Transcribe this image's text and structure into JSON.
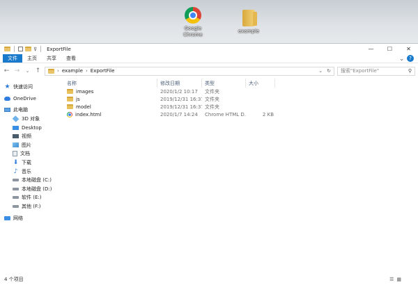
{
  "desktop": {
    "icons": [
      {
        "label_line1": "Google",
        "label_line2": "Chrome",
        "icon": "chrome-icon"
      },
      {
        "label_line1": "example",
        "label_line2": "",
        "icon": "folder-icon"
      }
    ]
  },
  "window": {
    "title": "ExportFile",
    "controls": {
      "minimize": "—",
      "maximize": "☐",
      "close": "✕"
    }
  },
  "ribbon": {
    "tabs": [
      "文件",
      "主页",
      "共享",
      "查看"
    ],
    "active_tab": "文件",
    "accent": "#1979ca"
  },
  "navigation": {
    "back": "←",
    "forward": "→",
    "recent": "⌄",
    "up": "↑",
    "breadcrumb": [
      "example",
      "ExportFile"
    ],
    "search_placeholder": "搜索\"ExportFile\""
  },
  "sidebar": {
    "items": [
      {
        "label": "快速访问",
        "icon": "star-icon",
        "level": 0
      },
      {
        "label": "OneDrive",
        "icon": "cloud-icon",
        "level": 0
      },
      {
        "label": "此电脑",
        "icon": "computer-icon",
        "level": 0
      },
      {
        "label": "3D 对象",
        "icon": "3d-objects-icon",
        "level": 1
      },
      {
        "label": "Desktop",
        "icon": "desktop-icon",
        "level": 1
      },
      {
        "label": "视频",
        "icon": "video-icon",
        "level": 1
      },
      {
        "label": "图片",
        "icon": "pictures-icon",
        "level": 1
      },
      {
        "label": "文档",
        "icon": "documents-icon",
        "level": 1
      },
      {
        "label": "下载",
        "icon": "downloads-icon",
        "level": 1
      },
      {
        "label": "音乐",
        "icon": "music-icon",
        "level": 1
      },
      {
        "label": "本地磁盘 (C:)",
        "icon": "drive-icon",
        "level": 1
      },
      {
        "label": "本地磁盘 (D:)",
        "icon": "drive-icon",
        "level": 1
      },
      {
        "label": "软件 (E:)",
        "icon": "drive-icon",
        "level": 1
      },
      {
        "label": "其他 (F:)",
        "icon": "drive-icon",
        "level": 1
      },
      {
        "label": "网络",
        "icon": "network-icon",
        "level": 0
      }
    ]
  },
  "file_list": {
    "columns": [
      "名称",
      "修改日期",
      "类型",
      "大小"
    ],
    "rows": [
      {
        "name": "images",
        "date": "2020/1/2 10:17",
        "type": "文件夹",
        "size": "",
        "icon": "folder-icon"
      },
      {
        "name": "js",
        "date": "2019/12/31 16:37",
        "type": "文件夹",
        "size": "",
        "icon": "folder-icon"
      },
      {
        "name": "model",
        "date": "2019/12/31 16:37",
        "type": "文件夹",
        "size": "",
        "icon": "folder-icon"
      },
      {
        "name": "index.html",
        "date": "2020/1/7 14:24",
        "type": "Chrome HTML D...",
        "size": "2 KB",
        "icon": "chrome-icon"
      }
    ]
  },
  "status": {
    "item_count": "4 个项目"
  }
}
